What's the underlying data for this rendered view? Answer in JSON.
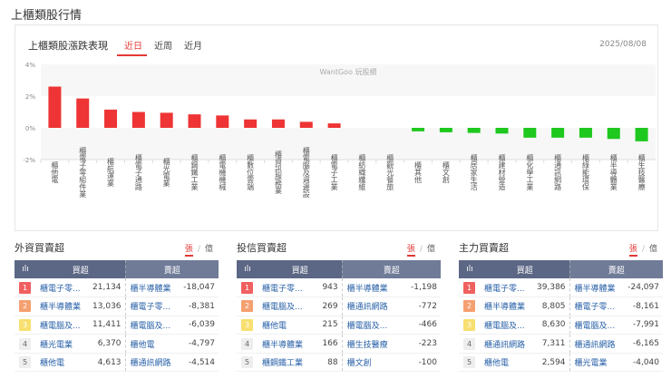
{
  "page_title": "上櫃類股行情",
  "chart_card": {
    "title": "上櫃類股漲跌表現",
    "tabs": [
      "近日",
      "近周",
      "近月"
    ],
    "active_tab": 0,
    "date": "2025/08/08",
    "watermark": "WantGoo 玩股網"
  },
  "chart_data": {
    "type": "bar",
    "title": "上櫃類股漲跌表現",
    "ylim": [
      -2,
      4
    ],
    "yticks": [
      "4%",
      "2%",
      "0%",
      "-2%"
    ],
    "ytick_values": [
      4,
      2,
      0,
      -2
    ],
    "categories": [
      "櫃他電",
      "櫃電子零組件業",
      "櫃航運業",
      "櫃電子通路",
      "櫃光電業",
      "櫃鋼鐵工業",
      "櫃電機機械",
      "櫃數位雲端",
      "櫃資訊服務業",
      "櫃電腦及週邊設",
      "櫃電子工業",
      "櫃紡織纖維",
      "櫃觀光餐旅",
      "櫃其他",
      "櫃文創",
      "櫃居家生活",
      "櫃建材營造",
      "櫃化學工業",
      "櫃通訊網路",
      "櫃綠能環保",
      "櫃半導體業",
      "櫃生技醫療"
    ],
    "values": [
      2.6,
      1.85,
      1.15,
      1.0,
      0.95,
      0.85,
      0.78,
      0.53,
      0.53,
      0.38,
      0.28,
      0,
      0,
      -0.22,
      -0.28,
      -0.32,
      -0.36,
      -0.62,
      -0.62,
      -0.62,
      -0.7,
      -0.85
    ],
    "colors": {
      "up": "#ee3434",
      "down": "#1ec81e"
    }
  },
  "rank_colors": [
    "#f06060",
    "#f5a070",
    "#f8e070",
    "#eeeeee",
    "#eeeeee"
  ],
  "sections": [
    {
      "title": "外資買賣超",
      "unit_on": "張",
      "unit_off": "億",
      "buy_header": "買超",
      "sell_header": "賣超",
      "rows": [
        {
          "rank": "1",
          "buy": "櫃電子零...",
          "buy_val": "21,134",
          "sell": "櫃半導體業",
          "sell_val": "-18,047"
        },
        {
          "rank": "2",
          "buy": "櫃半導體業",
          "buy_val": "13,036",
          "sell": "櫃電子零...",
          "sell_val": "-8,381"
        },
        {
          "rank": "3",
          "buy": "櫃電腦及...",
          "buy_val": "11,411",
          "sell": "櫃電腦及...",
          "sell_val": "-6,039"
        },
        {
          "rank": "4",
          "buy": "櫃光電業",
          "buy_val": "6,370",
          "sell": "櫃他電",
          "sell_val": "-4,797"
        },
        {
          "rank": "5",
          "buy": "櫃他電",
          "buy_val": "4,613",
          "sell": "櫃通訊網路",
          "sell_val": "-4,514"
        }
      ]
    },
    {
      "title": "投信買賣超",
      "unit_on": "張",
      "unit_off": "億",
      "buy_header": "買超",
      "sell_header": "賣超",
      "rows": [
        {
          "rank": "1",
          "buy": "櫃電子零...",
          "buy_val": "943",
          "sell": "櫃半導體業",
          "sell_val": "-1,198"
        },
        {
          "rank": "2",
          "buy": "櫃電腦及...",
          "buy_val": "269",
          "sell": "櫃通訊網路",
          "sell_val": "-772"
        },
        {
          "rank": "3",
          "buy": "櫃他電",
          "buy_val": "215",
          "sell": "櫃電腦及...",
          "sell_val": "-466"
        },
        {
          "rank": "4",
          "buy": "櫃半導體業",
          "buy_val": "166",
          "sell": "櫃生技醫療",
          "sell_val": "-223"
        },
        {
          "rank": "5",
          "buy": "櫃鋼鐵工業",
          "buy_val": "88",
          "sell": "櫃文創",
          "sell_val": "-100"
        }
      ]
    },
    {
      "title": "主力買賣超",
      "unit_on": "張",
      "unit_off": "億",
      "buy_header": "買超",
      "sell_header": "賣超",
      "rows": [
        {
          "rank": "1",
          "buy": "櫃電子零...",
          "buy_val": "39,386",
          "sell": "櫃半導體業",
          "sell_val": "-24,097"
        },
        {
          "rank": "2",
          "buy": "櫃半導體業",
          "buy_val": "8,805",
          "sell": "櫃電子零...",
          "sell_val": "-8,161"
        },
        {
          "rank": "3",
          "buy": "櫃電腦及...",
          "buy_val": "8,630",
          "sell": "櫃電腦及...",
          "sell_val": "-7,991"
        },
        {
          "rank": "4",
          "buy": "櫃通訊網路",
          "buy_val": "7,311",
          "sell": "櫃通訊網路",
          "sell_val": "-6,165"
        },
        {
          "rank": "5",
          "buy": "櫃他電",
          "buy_val": "2,594",
          "sell": "櫃光電業",
          "sell_val": "-4,040"
        }
      ]
    }
  ]
}
